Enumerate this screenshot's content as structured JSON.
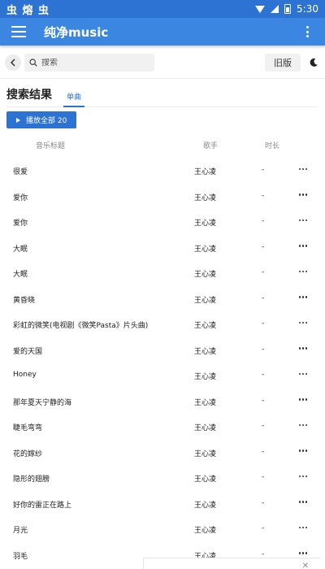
{
  "status_bar": {
    "left_text": "虫 熔 虫",
    "time": "5:30"
  },
  "app_bar": {
    "title": "纯净music"
  },
  "search": {
    "placeholder": "搜索",
    "old_version_label": "旧版"
  },
  "results": {
    "title": "搜索结果",
    "tab_single": "单曲",
    "play_all_label": "播放全部 20",
    "columns": {
      "title": "音乐标题",
      "artist": "歌手",
      "duration": "时长"
    },
    "songs": [
      {
        "title": "很爱",
        "artist": "王心凌",
        "duration": "-"
      },
      {
        "title": "爱你",
        "artist": "王心凌",
        "duration": "-"
      },
      {
        "title": "爱你",
        "artist": "王心凌",
        "duration": "-"
      },
      {
        "title": "大眠",
        "artist": "王心凌",
        "duration": "-"
      },
      {
        "title": "大眠",
        "artist": "王心凌",
        "duration": "-"
      },
      {
        "title": "黄昏晓",
        "artist": "王心凌",
        "duration": "-"
      },
      {
        "title": "彩虹的微笑(电视剧《微笑Pasta》片头曲)",
        "artist": "王心凌",
        "duration": "-"
      },
      {
        "title": "爱的天国",
        "artist": "王心凌",
        "duration": "-"
      },
      {
        "title": "Honey",
        "artist": "王心凌",
        "duration": "-"
      },
      {
        "title": "那年夏天宁静的海",
        "artist": "王心凌",
        "duration": "-"
      },
      {
        "title": "睫毛弯弯",
        "artist": "王心凌",
        "duration": "-"
      },
      {
        "title": "花的嫁纱",
        "artist": "王心凌",
        "duration": "-"
      },
      {
        "title": "隐形的翅膀",
        "artist": "王心凌",
        "duration": "-"
      },
      {
        "title": "好你的雷正在路上",
        "artist": "王心凌",
        "duration": "-"
      },
      {
        "title": "月光",
        "artist": "王心凌",
        "duration": "-"
      },
      {
        "title": "羽毛",
        "artist": "王心凌",
        "duration": "-"
      }
    ]
  },
  "icons": {
    "menu": "hamburger-icon",
    "more": "more-vertical-icon",
    "back": "chevron-left-icon",
    "search": "search-icon",
    "theme": "moon-icon",
    "play": "play-icon",
    "row_more": "more-horizontal-icon"
  },
  "colors": {
    "primary": "#3b86e0",
    "status_bar": "#2d73d3",
    "accent": "#2d73d3"
  }
}
